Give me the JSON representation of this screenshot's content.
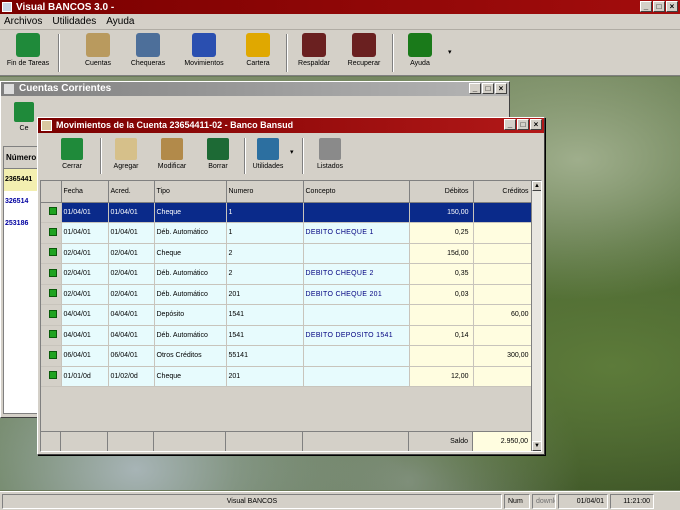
{
  "app": {
    "title": "Visual BANCOS 3.0 -",
    "win_buttons": [
      "_",
      "□",
      "×"
    ]
  },
  "menu": [
    "Archivos",
    "Utilidades",
    "Ayuda"
  ],
  "toolbar": [
    {
      "label": "Fin de Tareas",
      "icon": "exit-door-icon",
      "color": "#1f8a3a"
    },
    {
      "label": "Cuentas",
      "icon": "accounts-icon",
      "color": "#b99a5e"
    },
    {
      "label": "Chequeras",
      "icon": "checkbook-icon",
      "color": "#4d6f9a"
    },
    {
      "label": "Movimientos",
      "icon": "typewriter-icon",
      "color": "#2a4fb0"
    },
    {
      "label": "Cartera",
      "icon": "safe-icon",
      "color": "#e0a800"
    },
    {
      "label": "Respaldar",
      "icon": "backup-disk-icon",
      "color": "#6a2020"
    },
    {
      "label": "Recuperar",
      "icon": "restore-disk-icon",
      "color": "#6a2020"
    },
    {
      "label": "Ayuda",
      "icon": "help-book-icon",
      "color": "#1a7a1a"
    }
  ],
  "cuentas_window": {
    "title": "Cuentas Corrientes",
    "toolbar_label": "Ce",
    "column_header": "Número",
    "rows": [
      "2365441",
      "326514",
      "253186"
    ]
  },
  "movimientos_window": {
    "title": "Movimientos de la Cuenta 23654411-02 - Banco Bansud",
    "toolbar": [
      {
        "label": "Cerrar",
        "icon": "exit-door-icon",
        "color": "#1f8a3a"
      },
      {
        "label": "Agregar",
        "icon": "add-document-icon",
        "color": "#d6c08a"
      },
      {
        "label": "Modificar",
        "icon": "edit-pencil-icon",
        "color": "#b28a4a"
      },
      {
        "label": "Borrar",
        "icon": "trash-icon",
        "color": "#1d6a35"
      },
      {
        "label": "Utilidades",
        "icon": "calculator-icon",
        "color": "#2c6fa0"
      },
      {
        "label": "Listados",
        "icon": "printer-icon",
        "color": "#8a8a8a"
      }
    ],
    "columns": [
      "Fecha",
      "Acred.",
      "Tipo",
      "Numero",
      "Concepto",
      "Débitos",
      "Créditos"
    ],
    "rows": [
      {
        "fecha": "01/04/01",
        "acred": "01/04/01",
        "tipo": "Cheque",
        "numero": "1",
        "concepto": "",
        "debitos": "150,00",
        "creditos": "",
        "selected": true
      },
      {
        "fecha": "01/04/01",
        "acred": "01/04/01",
        "tipo": "Déb. Automático",
        "numero": "1",
        "concepto": "DEBITO CHEQUE 1",
        "debitos": "0,25",
        "creditos": ""
      },
      {
        "fecha": "02/04/01",
        "acred": "02/04/01",
        "tipo": "Cheque",
        "numero": "2",
        "concepto": "",
        "debitos": "15d,00",
        "creditos": ""
      },
      {
        "fecha": "02/04/01",
        "acred": "02/04/01",
        "tipo": "Déb. Automático",
        "numero": "2",
        "concepto": "DEBITO CHEQUE 2",
        "debitos": "0,35",
        "creditos": ""
      },
      {
        "fecha": "02/04/01",
        "acred": "02/04/01",
        "tipo": "Déb. Automático",
        "numero": "201",
        "concepto": "DEBITO CHEQUE 201",
        "debitos": "0,03",
        "creditos": ""
      },
      {
        "fecha": "04/04/01",
        "acred": "04/04/01",
        "tipo": "Depósito",
        "numero": "1541",
        "concepto": "",
        "debitos": "",
        "creditos": "60,00"
      },
      {
        "fecha": "04/04/01",
        "acred": "04/04/01",
        "tipo": "Déb. Automático",
        "numero": "1541",
        "concepto": "DEBITO DEPOSITO 1541",
        "debitos": "0,14",
        "creditos": ""
      },
      {
        "fecha": "06/04/01",
        "acred": "06/04/01",
        "tipo": "Otros Créditos",
        "numero": "55141",
        "concepto": "",
        "debitos": "",
        "creditos": "300,00"
      },
      {
        "fecha": "01/01/0d",
        "acred": "01/02/0d",
        "tipo": "Cheque",
        "numero": "201",
        "concepto": "",
        "debitos": "12,00",
        "creditos": ""
      }
    ],
    "footer": {
      "saldo_label": "Saldo",
      "saldo_value": "2.950,00"
    }
  },
  "statusbar": {
    "app_name": "Visual BANCOS",
    "num": "Num",
    "date": "01/04/01",
    "time": "11:21:00",
    "watermark": "downloads.officialcl.com"
  }
}
